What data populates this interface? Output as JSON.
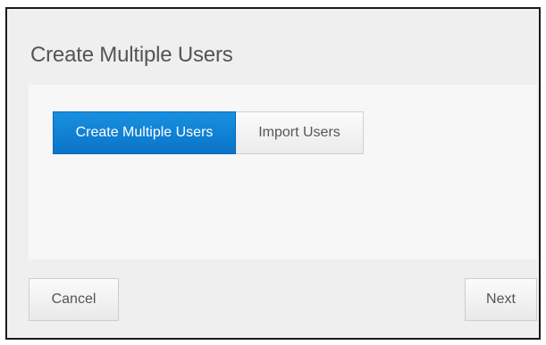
{
  "dialog": {
    "title": "Create Multiple Users",
    "tabs": [
      {
        "label": "Create Multiple Users",
        "active": true
      },
      {
        "label": "Import Users",
        "active": false
      }
    ],
    "footer": {
      "cancel_label": "Cancel",
      "next_label": "Next"
    }
  },
  "colors": {
    "accent": "#0a7fd6",
    "dialog_background": "#efefef",
    "panel_background": "#f7f7f7",
    "text": "#555555"
  }
}
